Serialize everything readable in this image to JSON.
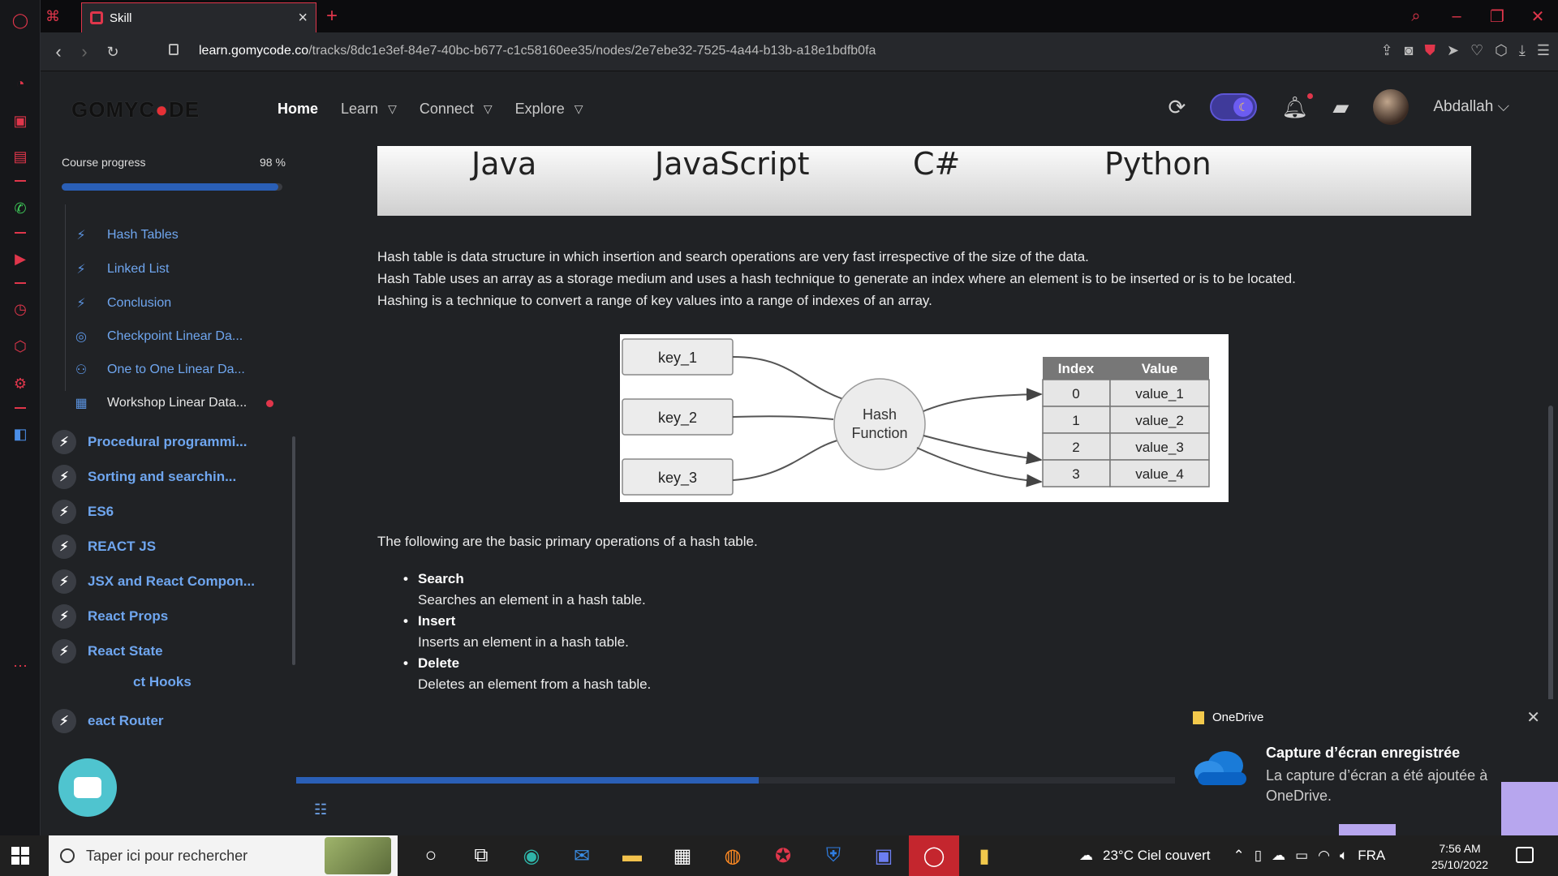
{
  "browser": {
    "tab_title": "Skill",
    "url_host": "learn.gomycode.co",
    "url_path": "/tracks/8dc1e3ef-84e7-40bc-b677-c1c58160ee35/nodes/2e7ebe32-7525-4a44-b13b-a18e1bdfb0fa"
  },
  "header": {
    "logo_a": "GOMYC",
    "logo_b": "DE",
    "nav": [
      {
        "label": "Home",
        "active": true
      },
      {
        "label": "Learn"
      },
      {
        "label": "Connect"
      },
      {
        "label": "Explore"
      }
    ],
    "user_name": "Abdallah"
  },
  "sidebar": {
    "progress_label": "Course progress",
    "progress_pct": "98 %",
    "progress_value": 0.98,
    "sub_items": [
      {
        "label": "Hash Tables",
        "icon": "bolt-icon"
      },
      {
        "label": "Linked List",
        "icon": "bolt-icon"
      },
      {
        "label": "Conclusion",
        "icon": "bolt-icon"
      },
      {
        "label": "Checkpoint Linear Da...",
        "icon": "target-icon"
      },
      {
        "label": "One to One Linear Da...",
        "icon": "people-icon"
      },
      {
        "label": "Workshop Linear Data...",
        "icon": "workshop-icon"
      }
    ],
    "chapters": [
      "Procedural programmi...",
      "Sorting and searchin...",
      "ES6",
      "REACT JS",
      "JSX and React Compon...",
      "React Props",
      "React State",
      "ct Hooks",
      "eact Router"
    ]
  },
  "content": {
    "languages": [
      "Java",
      "JavaScript",
      "C#",
      "Python"
    ],
    "paragraph_1": "Hash table is data structure in which insertion and search operations are very fast irrespective of the size of the data.",
    "paragraph_2": "Hash Table uses an array as a storage medium and uses a hash technique to generate an index where an element is to be inserted or is to be located.",
    "paragraph_3": "Hashing is a technique to convert a range of key values into a range of indexes of an array.",
    "diagram": {
      "keys": [
        "key_1",
        "key_2",
        "key_3"
      ],
      "function_line1": "Hash",
      "function_line2": "Function",
      "col_index": "Index",
      "col_value": "Value",
      "indexes": [
        "0",
        "1",
        "2",
        "3"
      ],
      "values": [
        "value_1",
        "value_2",
        "value_3",
        "value_4"
      ]
    },
    "ops_intro": "The following are the basic primary operations of a hash table.",
    "operations": [
      {
        "title": "Search",
        "desc": "Searches an element in a hash table."
      },
      {
        "title": "Insert",
        "desc": "Inserts an element in a hash table."
      },
      {
        "title": "Delete",
        "desc": "Deletes an element from a hash table."
      }
    ],
    "content_progress": 0.37
  },
  "toast": {
    "app": "OneDrive",
    "title": "Capture d’écran enregistrée",
    "body": "La capture d’écran a été ajoutée à OneDrive."
  },
  "taskbar": {
    "search_placeholder": "Taper ici pour rechercher",
    "weather": "23°C  Ciel couvert",
    "lang": "FRA",
    "time": "7:56 AM",
    "date": "25/10/2022"
  }
}
